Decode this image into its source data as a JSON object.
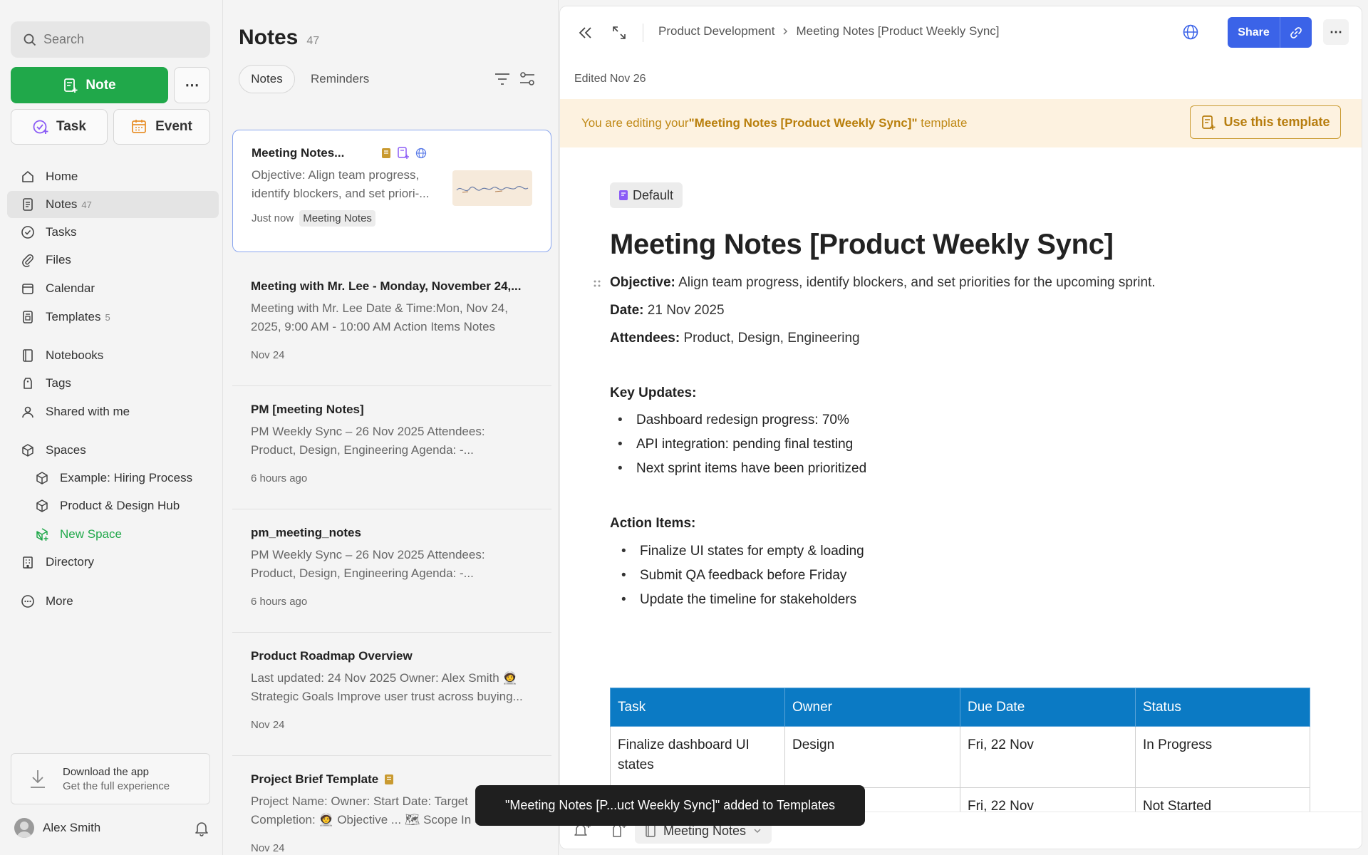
{
  "sidebar": {
    "search_placeholder": "Search",
    "note_button": "Note",
    "task_button": "Task",
    "event_button": "Event",
    "nav": {
      "home": "Home",
      "notes": "Notes",
      "notes_count": "47",
      "tasks": "Tasks",
      "files": "Files",
      "calendar": "Calendar",
      "templates": "Templates",
      "templates_count": "5",
      "notebooks": "Notebooks",
      "tags": "Tags",
      "shared": "Shared with me",
      "spaces": "Spaces",
      "space1": "Example: Hiring Process",
      "space2": "Product & Design Hub",
      "new_space": "New Space",
      "directory": "Directory",
      "more": "More"
    },
    "download_title": "Download the app",
    "download_sub": "Get the full experience",
    "user_name": "Alex Smith"
  },
  "list": {
    "title": "Notes",
    "count": "47",
    "tab_notes": "Notes",
    "tab_reminders": "Reminders",
    "cards": [
      {
        "title": "Meeting Notes...",
        "body": "Objective: Align team progress, identify blockers, and set priori-...",
        "date": "Just now",
        "tag": "Meeting Notes"
      },
      {
        "title": "Meeting with Mr. Lee - Monday, November 24,...",
        "body": "Meeting with Mr. Lee Date & Time:Mon, Nov 24, 2025, 9:00 AM - 10:00 AM Action Items Notes",
        "date": "Nov 24"
      },
      {
        "title": "PM [meeting Notes]",
        "body": "PM Weekly Sync – 26 Nov 2025 Attendees: Product, Design, Engineering Agenda: -...",
        "date": "6 hours ago"
      },
      {
        "title": "pm_meeting_notes",
        "body": "PM Weekly Sync – 26 Nov 2025 Attendees: Product, Design, Engineering Agenda: -...",
        "date": "6 hours ago"
      },
      {
        "title": "Product Roadmap Overview",
        "body": "Last updated: 24 Nov 2025 Owner: Alex Smith 🧑‍🚀 Strategic Goals Improve user trust across buying...",
        "date": "Nov 24"
      },
      {
        "title": "Project Brief Template",
        "body": "Project Name: Owner: Start Date: Target Completion: 🧑‍🚀 Objective ... 🗺 Scope In S",
        "date": "Nov 24"
      }
    ]
  },
  "editor": {
    "breadcrumb_parent": "Product Development",
    "breadcrumb_current": "Meeting Notes [Product Weekly Sync]",
    "share_label": "Share",
    "edited": "Edited Nov 26",
    "banner_prefix": "You are editing your ",
    "banner_name": "\"Meeting Notes [Product Weekly Sync]\"",
    "banner_suffix": " template",
    "use_template": "Use this template",
    "default_chip": "Default",
    "title": "Meeting Notes [Product Weekly Sync]",
    "objective_label": "Objective:",
    "objective_text": " Align team progress, identify blockers, and set priorities for the upcoming sprint.",
    "date_label": "Date:",
    "date_text": " 21 Nov 2025",
    "attendees_label": "Attendees:",
    "attendees_text": " Product, Design, Engineering",
    "key_updates": "Key Updates:",
    "updates": [
      "Dashboard redesign progress: 70%",
      "API integration: pending final testing",
      "Next sprint items have been prioritized"
    ],
    "action_items": "Action Items:",
    "actions": [
      "Finalize UI states for empty & loading",
      "Submit QA feedback before Friday",
      "Update the timeline for stakeholders"
    ],
    "table": {
      "headers": [
        "Task",
        "Owner",
        "Due Date",
        "Status"
      ],
      "rows": [
        [
          "Finalize dashboard UI states",
          "Design",
          "Fri, 22 Nov",
          "In Progress"
        ],
        [
          "",
          "",
          "Fri, 22 Nov",
          "Not Started"
        ]
      ]
    },
    "notebook_chip": "Meeting Notes"
  },
  "toast": "\"Meeting Notes [P...uct Weekly Sync]\" added to Templates",
  "colors": {
    "accent_green": "#20a84a",
    "share_blue": "#3b63e8",
    "table_header": "#0b7ac4",
    "banner_bg": "#fdf2e0"
  }
}
